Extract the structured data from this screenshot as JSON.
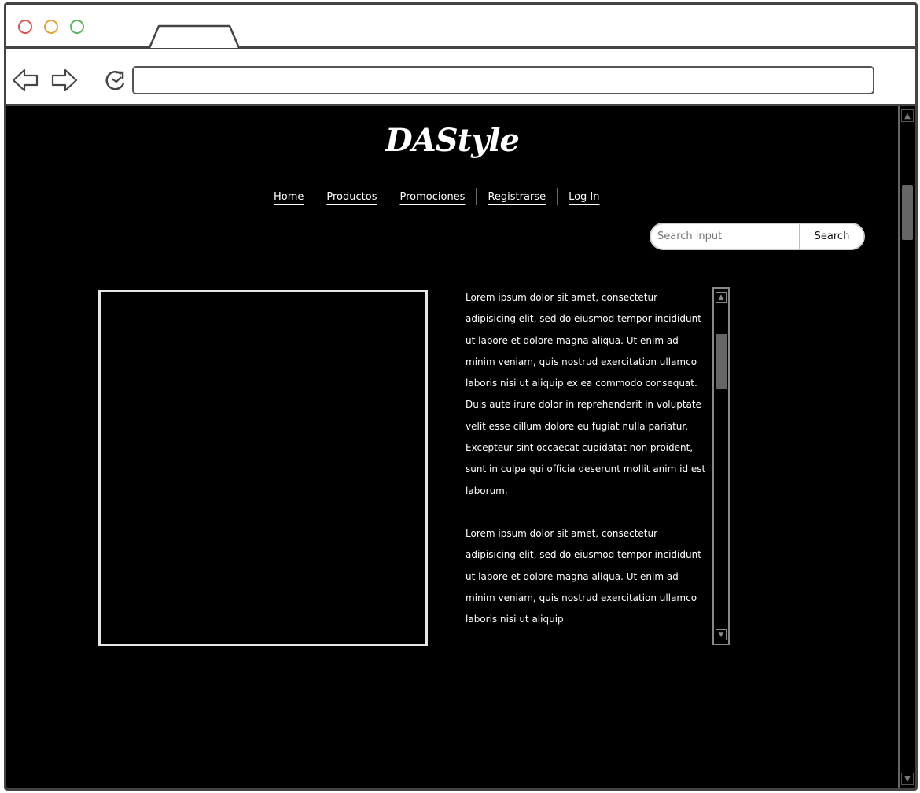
{
  "browser": {
    "url": "",
    "back_icon": "arrow-left-icon",
    "forward_icon": "arrow-right-icon",
    "reload_icon": "reload-icon"
  },
  "site": {
    "brand": "DAStyle",
    "nav": [
      {
        "label": "Home"
      },
      {
        "label": "Productos"
      },
      {
        "label": "Promociones"
      },
      {
        "label": "Registrarse"
      },
      {
        "label": "Log In"
      }
    ],
    "search": {
      "placeholder": "Search input",
      "button": "Search"
    },
    "body_paragraphs": [
      "Lorem ipsum dolor sit amet, consectetur adipisicing elit, sed do eiusmod tempor incididunt ut labore et dolore magna aliqua. Ut enim ad minim veniam, quis nostrud exercitation ullamco laboris nisi ut aliquip ex ea commodo consequat. Duis aute irure dolor in reprehenderit in voluptate velit esse cillum dolore eu fugiat nulla pariatur. Excepteur sint occaecat cupidatat non proident, sunt in culpa qui officia deserunt mollit anim id est laborum.",
      "Lorem ipsum dolor sit amet, consectetur adipisicing elit, sed do eiusmod tempor incididunt ut labore et dolore magna aliqua. Ut enim ad minim veniam, quis nostrud exercitation ullamco laboris nisi ut aliquip"
    ]
  },
  "colors": {
    "page_background": "#000000",
    "text": "#ffffff",
    "chrome": "#444444"
  }
}
